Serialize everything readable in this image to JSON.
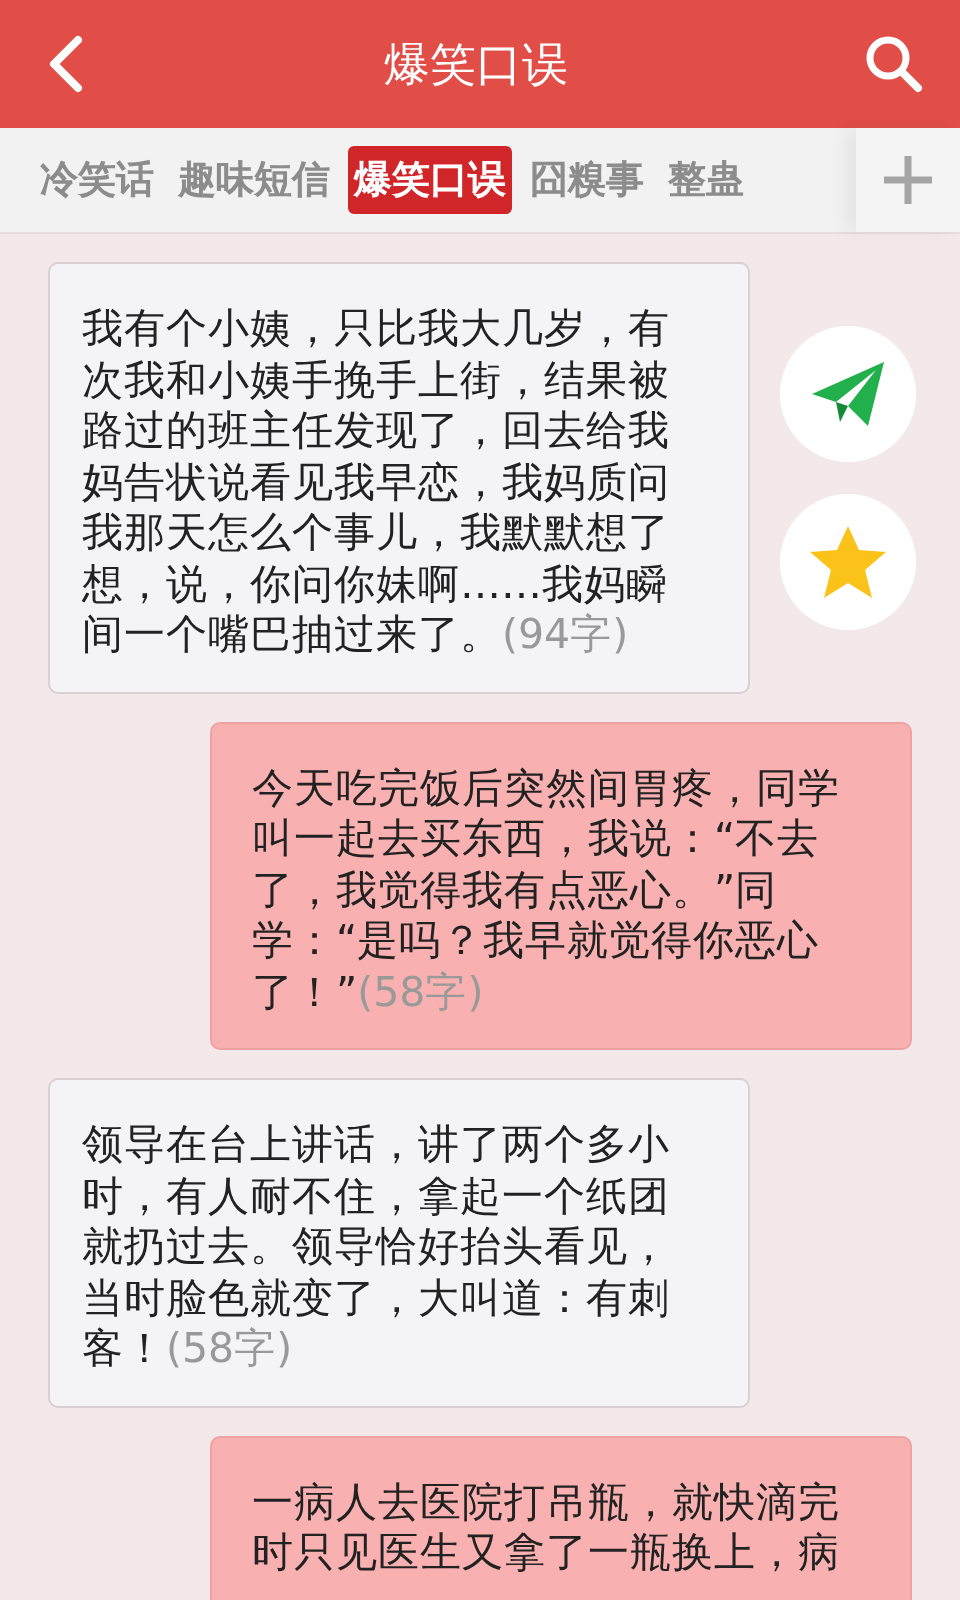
{
  "header": {
    "title": "爆笑口误"
  },
  "tabs": [
    {
      "label": "冷笑话",
      "selected": false
    },
    {
      "label": "趣味短信",
      "selected": false
    },
    {
      "label": "爆笑口误",
      "selected": true
    },
    {
      "label": "囧糗事",
      "selected": false
    },
    {
      "label": "整蛊",
      "selected": false
    }
  ],
  "messages": [
    {
      "kind": "left",
      "text": "我有个小姨，只比我大几岁，有次我和小姨手挽手上街，结果被路过的班主任发现了，回去给我妈告状说看见我早恋，我妈质问我那天怎么个事儿，我默默想了想，说，你问你妹啊……我妈瞬间一个嘴巴抽过来了。",
      "count": "(94字)"
    },
    {
      "kind": "right",
      "text": "今天吃完饭后突然间胃疼，同学叫一起去买东西，我说：“不去了，我觉得我有点恶心。”同学：“是吗？我早就觉得你恶心了！”",
      "count": "(58字)"
    },
    {
      "kind": "left",
      "text": "领导在台上讲话，讲了两个多小时，有人耐不住，拿起一个纸团就扔过去。领导恰好抬头看见，当时脸色就变了，大叫道：有刺客！",
      "count": "(58字)"
    },
    {
      "kind": "right",
      "text": "一病人去医院打吊瓶，就快滴完时只见医生又拿了一瓶换上，病"
    }
  ]
}
